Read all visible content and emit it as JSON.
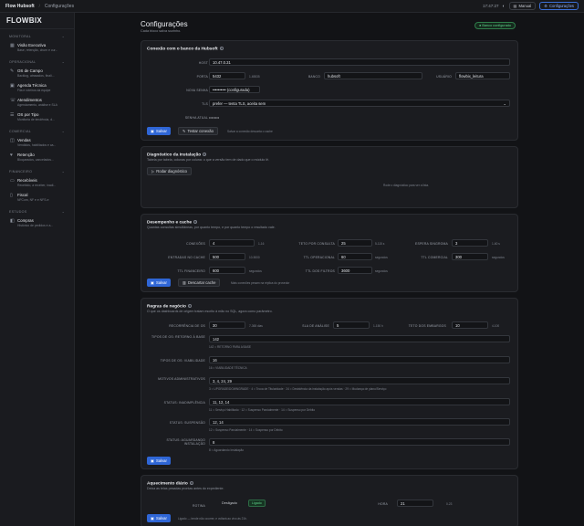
{
  "topbar": {
    "app": "Flow Hubsoft",
    "crumb": "Configurações",
    "clock": "17:47:27",
    "manual": "Manual",
    "config": "Configurações"
  },
  "sidebar": {
    "logo": "FLOWBIX",
    "sections": [
      {
        "title": "MONITORAL"
      },
      {
        "title": "OPERACIONAL"
      },
      {
        "title": "COMERCIAL"
      },
      {
        "title": "FINANCEIRO"
      },
      {
        "title": "ESTUDOS"
      }
    ],
    "items": [
      {
        "label": "Visão Executiva",
        "sub": "Base, retenção, churn e cur..."
      },
      {
        "label": "OS de Campo",
        "sub": "Backlog, atrasados, finali..."
      },
      {
        "label": "Agenda Técnica",
        "sub": "Fila e roteiros da equipe"
      },
      {
        "label": "Atendimentos",
        "sub": "Agendamento, análise e SLA"
      },
      {
        "label": "OS por Tipo",
        "sub": "Monitoria de tendência, d..."
      },
      {
        "label": "Vendas",
        "sub": "Vendidos, habilitados e ca..."
      },
      {
        "label": "Retenção",
        "sub": "Bloqueados, cancelados..."
      },
      {
        "label": "Recebíveis",
        "sub": "Recebido, a receber, inadi..."
      },
      {
        "label": "Fiscal",
        "sub": "NFCom, NF e e NFS-e"
      },
      {
        "label": "Compras",
        "sub": "Histórico de pedidos e a..."
      }
    ]
  },
  "page": {
    "title": "Configurações",
    "subtitle": "Cada bloco salva sozinho.",
    "badge": "Banco configurado"
  },
  "conn": {
    "title": "Conexão com o banco da Hubsoft",
    "host_label": "HOST",
    "host": "10.47.0.31",
    "port_label": "PORTA",
    "port": "5432",
    "port_hint": "1-65535",
    "db_label": "BANCO",
    "db": "hubsoft",
    "user_label": "USUÁRIO",
    "user": "flowbix_leitura",
    "pass_label": "NOVA SENHA",
    "pass": "•••••••••• (configurada)",
    "tls_label": "TLS",
    "tls": "prefer — tenta TLS, aceita sem",
    "cur_label": "SENHA ATUAL",
    "cur": "••••••••",
    "save": "Salvar",
    "test": "Testar conexão",
    "hint": "Salvar a conexão descarta o cache"
  },
  "diag": {
    "title": "Diagnóstico da instalação",
    "sub": "Tabela por tabela, colunas por coluna: o que a versão tem de dado que o módulo lê.",
    "run": "Rodar diagnóstico",
    "empty": "Rode o diagnóstico para ver a lista."
  },
  "perf": {
    "title": "Desempenho e cache",
    "sub": "Quantas consultas simultâneas, por quanto tempo, e por quanto tempo o resultado vale.",
    "f": [
      {
        "label": "CONEXÕES",
        "value": "4",
        "hint": "1-16"
      },
      {
        "label": "TETO POR CONSULTA",
        "value": "25",
        "hint": "5-115 s"
      },
      {
        "label": "ESPERA SINGROMA",
        "value": "3",
        "hint": "1-60 s"
      },
      {
        "label": "ENTRADAS NO CACHE",
        "value": "500",
        "hint": "10-5000"
      },
      {
        "label": "TTL OPERACIONAL",
        "value": "60",
        "hint": "segundos"
      },
      {
        "label": "TTL COMERCIAL",
        "value": "300",
        "hint": "segundos"
      },
      {
        "label": "TTL FINANCEIRO",
        "value": "600",
        "hint": "segundos"
      },
      {
        "label": "TTL DOS FILTROS",
        "value": "3600",
        "hint": "segundos"
      }
    ],
    "save": "Salvar",
    "discard": "Descartar cache",
    "hint": "Mais conexões pesam na réplica do provedor"
  },
  "rules": {
    "title": "Regras de negócio",
    "sub": "O que os dashboards de origem tratam escrito à mão no SQL, agora como parâmetro.",
    "row1": [
      {
        "label": "RECORRÊNCIA DE OS",
        "value": "30",
        "hint": "7-365 dias"
      },
      {
        "label": "SLA DE ANÁLISE",
        "value": "5",
        "hint": "1-150 h"
      },
      {
        "label": "TETO DOS EMBARGOS",
        "value": "10",
        "hint": "4-100"
      }
    ],
    "f": [
      {
        "label": "TIPOS DE OS: RETORNO À BASE",
        "value": "142",
        "hint": "142 = RETORNO PARA A BASE"
      },
      {
        "label": "TIPOS DE OS: VIABILIDADE",
        "value": "16",
        "hint": "16 = VIABILIDADE TÉCNICA"
      },
      {
        "label": "MOTIVOS ADMINISTRATIVOS",
        "value": "3, 4, 24, 29",
        "hint": "3 = UPGRADE/DOWNGRADE · 4 = Troca de Titularidade · 24 = Desistência da instalação após vendas · 29 = Mudança de plano/Serviço"
      },
      {
        "label": "STATUS: INADIMPLÊNCIA",
        "value": "11, 12, 14",
        "hint": "11 = Serviço Habilitado · 12 = Suspenso Parcialmente · 14 = Suspenso por Débito"
      },
      {
        "label": "STATUS: SUSPENSÃO",
        "value": "12, 14",
        "hint": "12 = Suspenso Parcialmente · 14 = Suspenso por Débito"
      },
      {
        "label": "STATUS: AGUARDANDO INSTALAÇÃO",
        "value": "8",
        "hint": "8 = Aguardando Instalação"
      }
    ],
    "save": "Salvar"
  },
  "warm": {
    "title": "Aquecimento diário",
    "sub": "Deixa as telas pesadas prontas antes do expediente.",
    "rot_label": "ROTINA",
    "off": "Desligado",
    "on": "Ligado",
    "hour_label": "HORA",
    "hour": "21",
    "hour_hint": "0-23",
    "save": "Salvar",
    "hint": "Ligado — tende não ocorrer, e voltará ao vivo às 21h."
  }
}
